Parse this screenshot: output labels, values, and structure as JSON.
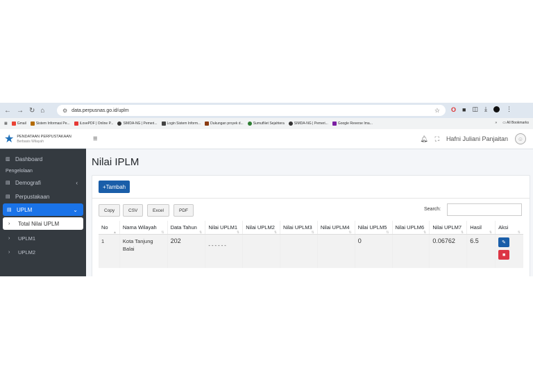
{
  "browser": {
    "url": "data.perpusnas.go.id/uplm",
    "bookmarks": [
      "Gmail",
      "Sistem Informasi Pe...",
      "iLovePDF | Online P...",
      "SIMDA-NG | Pemeri...",
      "Login Sistem Inform...",
      "Dukungan proyek d...",
      "SumutNet Sejahtera",
      "SIMDA-NG | Pemeri...",
      "Google Reverse Ima..."
    ],
    "all_bookmarks": "All Bookmarks"
  },
  "brand": {
    "title": "PENDATAAN PERPUSTAKAAN",
    "subtitle": "Berbasis Wilayah"
  },
  "sidebar": {
    "dashboard": "Dashboard",
    "section": "Pengelolaan",
    "demografi": "Demografi",
    "perpustakaan": "Perpustakaan",
    "uplm": "UPLM",
    "total_nilai": "Total Nilai UPLM",
    "uplm1": "UPLM1",
    "uplm2": "UPLM2"
  },
  "header": {
    "user": "Hafni Juliani Panjaitan"
  },
  "page": {
    "title": "Nilai IPLM",
    "add_button": "+Tambah"
  },
  "toolbar": {
    "copy": "Copy",
    "csv": "CSV",
    "excel": "Excel",
    "pdf": "PDF",
    "search_label": "Search:"
  },
  "table": {
    "headers": [
      "No",
      "Nama Wilayah",
      "Data Tahun",
      "Nilai UPLM1",
      "Nilai UPLM2",
      "Nilai UPLM3",
      "Nilai UPLM4",
      "Nilai UPLM5",
      "Nilai UPLM6",
      "Nilai UPLM7",
      "Hasil",
      "Aksi"
    ],
    "row": [
      "1",
      "Kota Tanjung Balai",
      "202",
      "- - - - - -",
      "",
      "",
      "",
      "0",
      "",
      "0.06762",
      "6.5"
    ]
  },
  "colors": {
    "primary": "#1a5ea9",
    "danger": "#dc3545",
    "sidebar": "#343a40",
    "active": "#1a73e8"
  }
}
